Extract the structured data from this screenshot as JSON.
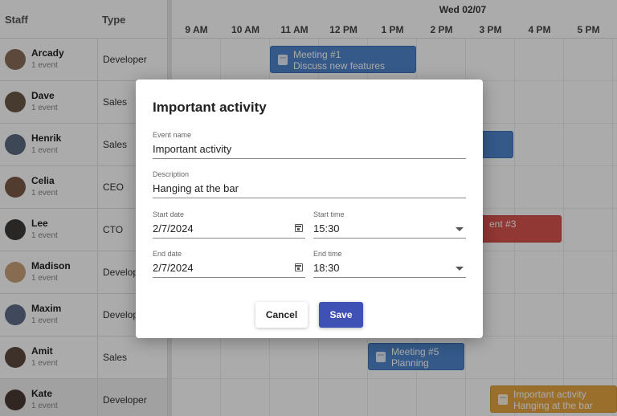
{
  "header": {
    "staff_label": "Staff",
    "type_label": "Type",
    "date": "Wed 02/07"
  },
  "hours": [
    "9 AM",
    "10 AM",
    "11 AM",
    "12 PM",
    "1 PM",
    "2 PM",
    "3 PM",
    "4 PM",
    "5 PM"
  ],
  "staff": [
    {
      "name": "Arcady",
      "events": "1 event",
      "type": "Developer",
      "avatar_color": "#8a6d5a"
    },
    {
      "name": "Dave",
      "events": "1 event",
      "type": "Sales",
      "avatar_color": "#6b5848"
    },
    {
      "name": "Henrik",
      "events": "1 event",
      "type": "Sales",
      "avatar_color": "#5d6a80"
    },
    {
      "name": "Celia",
      "events": "1 event",
      "type": "CEO",
      "avatar_color": "#7a5a46"
    },
    {
      "name": "Lee",
      "events": "1 event",
      "type": "CTO",
      "avatar_color": "#3d3b3a"
    },
    {
      "name": "Madison",
      "events": "1 event",
      "type": "Developer",
      "avatar_color": "#c9a27a"
    },
    {
      "name": "Maxim",
      "events": "1 event",
      "type": "Developer",
      "avatar_color": "#5e6e88"
    },
    {
      "name": "Amit",
      "events": "1 event",
      "type": "Sales",
      "avatar_color": "#5c4a3f"
    },
    {
      "name": "Kate",
      "events": "1 event",
      "type": "Developer",
      "avatar_color": "#4a3a33"
    }
  ],
  "events": [
    {
      "title": "Meeting #1",
      "subtitle": "Discuss new features",
      "color": "#4f86cc"
    },
    {
      "title": "",
      "subtitle": "",
      "color": "#4f86cc"
    },
    {
      "title": "ent #3",
      "subtitle": "",
      "color": "#d9524e"
    },
    {
      "title": "Meeting #5",
      "subtitle": "Planning",
      "color": "#4f86cc"
    },
    {
      "title": "Important activity",
      "subtitle": "Hanging at the bar",
      "color": "#e6a640"
    }
  ],
  "dialog": {
    "title": "Important activity",
    "event_name": {
      "label": "Event name",
      "value": "Important activity"
    },
    "description": {
      "label": "Description",
      "value": "Hanging at the bar"
    },
    "start_date": {
      "label": "Start date",
      "value": "2/7/2024"
    },
    "start_time": {
      "label": "Start time",
      "value": "15:30"
    },
    "end_date": {
      "label": "End date",
      "value": "2/7/2024"
    },
    "end_time": {
      "label": "End time",
      "value": "18:30"
    },
    "cancel_label": "Cancel",
    "save_label": "Save"
  },
  "colors": {
    "primary": "#3f51b5",
    "overlay": "rgba(0,0,0,0.33)"
  }
}
